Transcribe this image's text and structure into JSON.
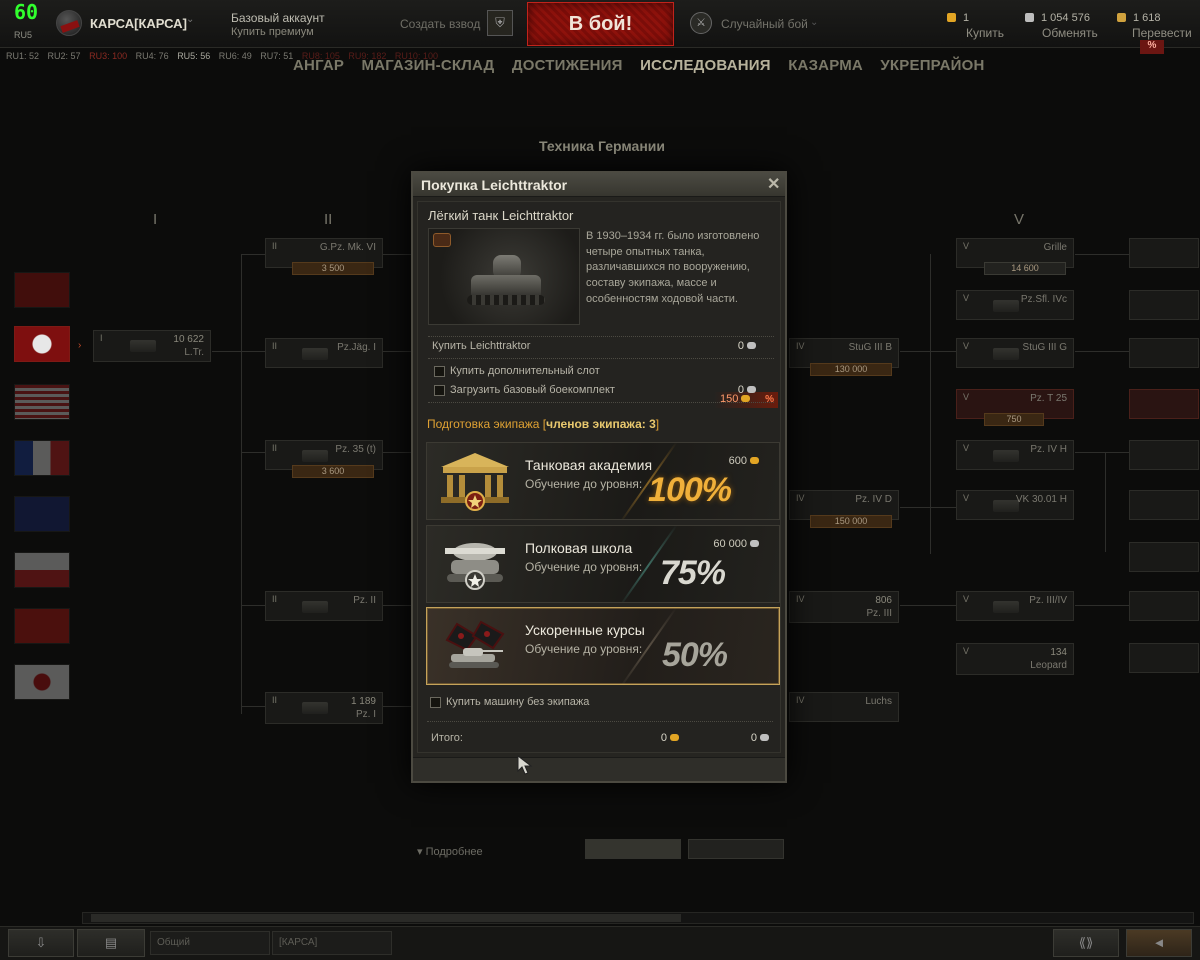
{
  "topbar": {
    "fps": "60",
    "fps_sub": "RU5",
    "player_name": "КАРСА[КАРСА]",
    "account_type": "Базовый аккаунт",
    "buy_premium": "Купить премиум",
    "create_platoon": "Создать взвод",
    "battle_button": "В бой!",
    "battle_mode": "Случайный бой",
    "gold_value": "1",
    "gold_action": "Купить",
    "credits_value": "1 054 576",
    "credits_action": "Обменять",
    "free_xp_value": "1 618",
    "free_xp_action": "Перевести",
    "discount_badge": "%"
  },
  "server_stats": [
    "RU1: 52",
    "RU2: 57",
    "RU3: 100",
    "RU4: 76",
    "RU5: 56",
    "RU6: 49",
    "RU7: 51",
    "RU8: 105",
    "RU9: 182",
    "RU10: 100"
  ],
  "nav": {
    "tabs": [
      "АНГАР",
      "МАГАЗИН-СКЛАД",
      "ДОСТИЖЕНИЯ",
      "ИССЛЕДОВАНИЯ",
      "КАЗАРМА",
      "УКРЕПРАЙОН"
    ],
    "active": "ИССЛЕДОВАНИЯ"
  },
  "tree": {
    "title": "Техника Германии",
    "tiers": [
      "I",
      "II",
      "V"
    ],
    "nations": [
      "ussr",
      "germany",
      "usa",
      "france",
      "uk",
      "czech",
      "china",
      "japan"
    ],
    "nodes_left": [
      {
        "tier": "II",
        "name": "G.Pz. Mk. VI",
        "price": "3 500"
      },
      {
        "tier": "I",
        "name": "L.Tr.",
        "xp": "10 622"
      },
      {
        "tier": "II",
        "name": "Pz.Jäg. I"
      },
      {
        "tier": "II",
        "name": "Pz. 35 (t)",
        "price": "3 600"
      },
      {
        "tier": "II",
        "name": "Pz. II"
      },
      {
        "tier": "II",
        "name": "Pz. I",
        "xp": "1 189"
      }
    ],
    "nodes_right": [
      {
        "tier": "V",
        "name": "Grille",
        "price": "14 600"
      },
      {
        "tier": "V",
        "name": "Pz.Sfl. IVc"
      },
      {
        "tier": "IV",
        "name": "StuG III B",
        "price": "130 000"
      },
      {
        "tier": "V",
        "name": "StuG III G"
      },
      {
        "tier": "V",
        "name": "Pz. T 25",
        "price": "750"
      },
      {
        "tier": "V",
        "name": "Pz. IV H"
      },
      {
        "tier": "IV",
        "name": "Pz. IV D",
        "price": "150 000"
      },
      {
        "tier": "V",
        "name": "VK 30.01 H"
      },
      {
        "tier": "IV",
        "name": "Pz. III",
        "xp": "806"
      },
      {
        "tier": "V",
        "name": "Pz. III/IV"
      },
      {
        "tier": "V",
        "name": "Leopard",
        "xp": "134"
      },
      {
        "tier": "IV",
        "name": "Luchs"
      }
    ],
    "details_label": "Подробнее"
  },
  "modal": {
    "title": "Покупка Leichttraktor",
    "tank_name": "Лёгкий танк Leichttraktor",
    "description": "В 1930–1934 гг. было изготовлено четыре опытных танка, различавшихся по вооружению, составу экипажа, массе и особенностям ходовой части.",
    "buy_label": "Купить Leichttraktor",
    "buy_price": "0",
    "slot_label": "Купить дополнительный слот",
    "slot_price": "150",
    "slot_discount": "%",
    "ammo_label": "Загрузить базовый боекомплект",
    "ammo_price": "0",
    "crew_title_prefix": "Подготовка экипажа [",
    "crew_title_bold": "членов экипажа: 3",
    "crew_title_suffix": "]",
    "crew_options": [
      {
        "name": "Танковая академия",
        "subtitle": "Обучение до уровня:",
        "percent": "100%",
        "price": "600",
        "currency": "gold"
      },
      {
        "name": "Полковая школа",
        "subtitle": "Обучение до уровня:",
        "percent": "75%",
        "price": "60 000",
        "currency": "credits"
      },
      {
        "name": "Ускоренные курсы",
        "subtitle": "Обучение до уровня:",
        "percent": "50%",
        "price": "",
        "currency": "free",
        "selected": true
      }
    ],
    "no_crew_label": "Купить машину без экипажа",
    "total_label": "Итого:",
    "total_gold": "0",
    "total_credits": "0"
  },
  "footer": {
    "channel_general": "Общий",
    "channel_clan": "[КАРСА]"
  },
  "colors": {
    "accent_gold": "#e0a233",
    "battle_red": "#8e120c",
    "selected_border": "#c5a35a"
  }
}
